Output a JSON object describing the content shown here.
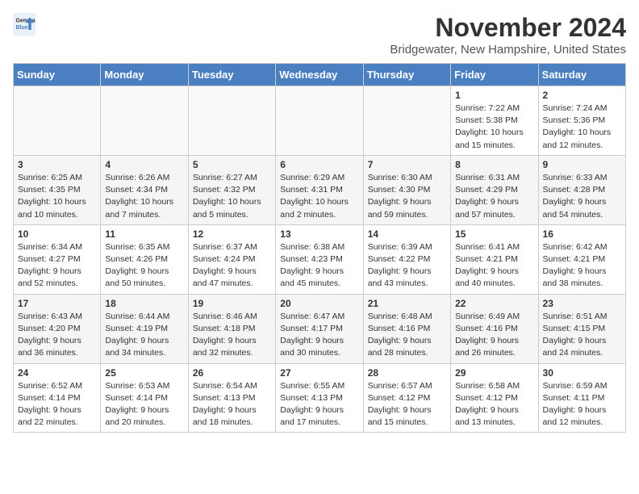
{
  "logo": {
    "line1": "General",
    "line2": "Blue"
  },
  "title": "November 2024",
  "location": "Bridgewater, New Hampshire, United States",
  "days_of_week": [
    "Sunday",
    "Monday",
    "Tuesday",
    "Wednesday",
    "Thursday",
    "Friday",
    "Saturday"
  ],
  "weeks": [
    [
      {
        "day": "",
        "info": ""
      },
      {
        "day": "",
        "info": ""
      },
      {
        "day": "",
        "info": ""
      },
      {
        "day": "",
        "info": ""
      },
      {
        "day": "",
        "info": ""
      },
      {
        "day": "1",
        "info": "Sunrise: 7:22 AM\nSunset: 5:38 PM\nDaylight: 10 hours and 15 minutes."
      },
      {
        "day": "2",
        "info": "Sunrise: 7:24 AM\nSunset: 5:36 PM\nDaylight: 10 hours and 12 minutes."
      }
    ],
    [
      {
        "day": "3",
        "info": "Sunrise: 6:25 AM\nSunset: 4:35 PM\nDaylight: 10 hours and 10 minutes."
      },
      {
        "day": "4",
        "info": "Sunrise: 6:26 AM\nSunset: 4:34 PM\nDaylight: 10 hours and 7 minutes."
      },
      {
        "day": "5",
        "info": "Sunrise: 6:27 AM\nSunset: 4:32 PM\nDaylight: 10 hours and 5 minutes."
      },
      {
        "day": "6",
        "info": "Sunrise: 6:29 AM\nSunset: 4:31 PM\nDaylight: 10 hours and 2 minutes."
      },
      {
        "day": "7",
        "info": "Sunrise: 6:30 AM\nSunset: 4:30 PM\nDaylight: 9 hours and 59 minutes."
      },
      {
        "day": "8",
        "info": "Sunrise: 6:31 AM\nSunset: 4:29 PM\nDaylight: 9 hours and 57 minutes."
      },
      {
        "day": "9",
        "info": "Sunrise: 6:33 AM\nSunset: 4:28 PM\nDaylight: 9 hours and 54 minutes."
      }
    ],
    [
      {
        "day": "10",
        "info": "Sunrise: 6:34 AM\nSunset: 4:27 PM\nDaylight: 9 hours and 52 minutes."
      },
      {
        "day": "11",
        "info": "Sunrise: 6:35 AM\nSunset: 4:26 PM\nDaylight: 9 hours and 50 minutes."
      },
      {
        "day": "12",
        "info": "Sunrise: 6:37 AM\nSunset: 4:24 PM\nDaylight: 9 hours and 47 minutes."
      },
      {
        "day": "13",
        "info": "Sunrise: 6:38 AM\nSunset: 4:23 PM\nDaylight: 9 hours and 45 minutes."
      },
      {
        "day": "14",
        "info": "Sunrise: 6:39 AM\nSunset: 4:22 PM\nDaylight: 9 hours and 43 minutes."
      },
      {
        "day": "15",
        "info": "Sunrise: 6:41 AM\nSunset: 4:21 PM\nDaylight: 9 hours and 40 minutes."
      },
      {
        "day": "16",
        "info": "Sunrise: 6:42 AM\nSunset: 4:21 PM\nDaylight: 9 hours and 38 minutes."
      }
    ],
    [
      {
        "day": "17",
        "info": "Sunrise: 6:43 AM\nSunset: 4:20 PM\nDaylight: 9 hours and 36 minutes."
      },
      {
        "day": "18",
        "info": "Sunrise: 6:44 AM\nSunset: 4:19 PM\nDaylight: 9 hours and 34 minutes."
      },
      {
        "day": "19",
        "info": "Sunrise: 6:46 AM\nSunset: 4:18 PM\nDaylight: 9 hours and 32 minutes."
      },
      {
        "day": "20",
        "info": "Sunrise: 6:47 AM\nSunset: 4:17 PM\nDaylight: 9 hours and 30 minutes."
      },
      {
        "day": "21",
        "info": "Sunrise: 6:48 AM\nSunset: 4:16 PM\nDaylight: 9 hours and 28 minutes."
      },
      {
        "day": "22",
        "info": "Sunrise: 6:49 AM\nSunset: 4:16 PM\nDaylight: 9 hours and 26 minutes."
      },
      {
        "day": "23",
        "info": "Sunrise: 6:51 AM\nSunset: 4:15 PM\nDaylight: 9 hours and 24 minutes."
      }
    ],
    [
      {
        "day": "24",
        "info": "Sunrise: 6:52 AM\nSunset: 4:14 PM\nDaylight: 9 hours and 22 minutes."
      },
      {
        "day": "25",
        "info": "Sunrise: 6:53 AM\nSunset: 4:14 PM\nDaylight: 9 hours and 20 minutes."
      },
      {
        "day": "26",
        "info": "Sunrise: 6:54 AM\nSunset: 4:13 PM\nDaylight: 9 hours and 18 minutes."
      },
      {
        "day": "27",
        "info": "Sunrise: 6:55 AM\nSunset: 4:13 PM\nDaylight: 9 hours and 17 minutes."
      },
      {
        "day": "28",
        "info": "Sunrise: 6:57 AM\nSunset: 4:12 PM\nDaylight: 9 hours and 15 minutes."
      },
      {
        "day": "29",
        "info": "Sunrise: 6:58 AM\nSunset: 4:12 PM\nDaylight: 9 hours and 13 minutes."
      },
      {
        "day": "30",
        "info": "Sunrise: 6:59 AM\nSunset: 4:11 PM\nDaylight: 9 hours and 12 minutes."
      }
    ]
  ]
}
